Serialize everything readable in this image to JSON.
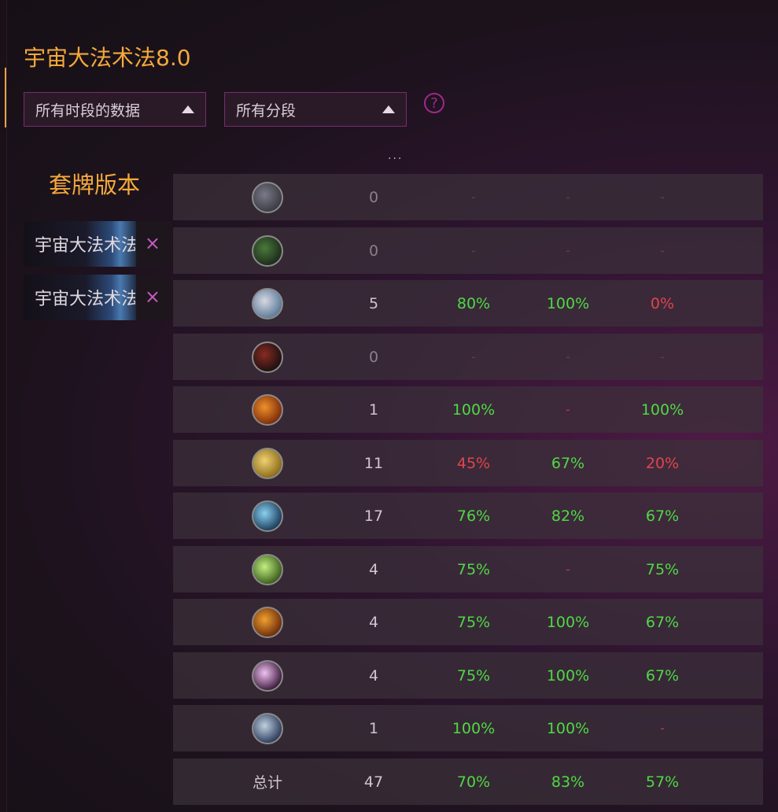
{
  "page": {
    "title": "宇宙大法术法8.0"
  },
  "filters": {
    "period_label": "所有时段的数据",
    "segment_label": "所有分段",
    "help_label": "?"
  },
  "misc": {
    "dots": "..."
  },
  "decks": {
    "header": "套牌版本",
    "items": [
      {
        "name": "宇宙大法术法",
        "close": "×"
      },
      {
        "name": "宇宙大法术法",
        "close": "×"
      }
    ]
  },
  "table": {
    "rows": [
      {
        "icon": "gray-dragon-icon",
        "count": "0",
        "a": "-",
        "b": "-",
        "c": "-",
        "a_cls": "dash",
        "b_cls": "dash",
        "c_cls": "dash",
        "dim": true
      },
      {
        "icon": "green-orc-icon",
        "count": "0",
        "a": "-",
        "b": "-",
        "c": "-",
        "a_cls": "dash",
        "b_cls": "dash",
        "c_cls": "dash",
        "dim": true
      },
      {
        "icon": "white-claw-icon",
        "count": "5",
        "a": "80%",
        "b": "100%",
        "c": "0%",
        "a_cls": "green",
        "b_cls": "green",
        "c_cls": "red",
        "dim": false
      },
      {
        "icon": "red-bow-icon",
        "count": "0",
        "a": "-",
        "b": "-",
        "c": "-",
        "a_cls": "dash",
        "b_cls": "dash",
        "c_cls": "dash",
        "dim": true
      },
      {
        "icon": "fire-icon",
        "count": "1",
        "a": "100%",
        "b": "-",
        "c": "100%",
        "a_cls": "green",
        "b_cls": "dash",
        "c_cls": "green",
        "dim": false
      },
      {
        "icon": "gold-scroll-icon",
        "count": "11",
        "a": "45%",
        "b": "67%",
        "c": "20%",
        "a_cls": "red",
        "b_cls": "green",
        "c_cls": "red",
        "dim": false
      },
      {
        "icon": "blue-hammer-icon",
        "count": "17",
        "a": "76%",
        "b": "82%",
        "c": "67%",
        "a_cls": "green",
        "b_cls": "green",
        "c_cls": "green",
        "dim": false
      },
      {
        "icon": "green-bolt-icon",
        "count": "4",
        "a": "75%",
        "b": "-",
        "c": "75%",
        "a_cls": "green",
        "b_cls": "dash",
        "c_cls": "green",
        "dim": false
      },
      {
        "icon": "orange-banner-icon",
        "count": "4",
        "a": "75%",
        "b": "100%",
        "c": "67%",
        "a_cls": "green",
        "b_cls": "green",
        "c_cls": "green",
        "dim": false
      },
      {
        "icon": "purple-hand-icon",
        "count": "4",
        "a": "75%",
        "b": "100%",
        "c": "67%",
        "a_cls": "green",
        "b_cls": "green",
        "c_cls": "green",
        "dim": false
      },
      {
        "icon": "steel-sword-icon",
        "count": "1",
        "a": "100%",
        "b": "100%",
        "c": "-",
        "a_cls": "green",
        "b_cls": "green",
        "c_cls": "dash",
        "dim": false
      }
    ],
    "total": {
      "label": "总计",
      "count": "47",
      "a": "70%",
      "b": "83%",
      "c": "57%"
    }
  },
  "icon_colors": {
    "gray-dragon-icon": [
      "#3a3a44",
      "#7a7a88"
    ],
    "green-orc-icon": [
      "#1c2a1a",
      "#4a7a3a"
    ],
    "white-claw-icon": [
      "#5a7a9a",
      "#d8d8e0"
    ],
    "red-bow-icon": [
      "#1a1012",
      "#8a2a22"
    ],
    "fire-icon": [
      "#7a2a0a",
      "#f0902a"
    ],
    "gold-scroll-icon": [
      "#8a6a1a",
      "#f0d070"
    ],
    "blue-hammer-icon": [
      "#1a3a5a",
      "#8ad0f0"
    ],
    "green-bolt-icon": [
      "#3a5a1a",
      "#c0f080"
    ],
    "orange-banner-icon": [
      "#6a2a0a",
      "#f0a030"
    ],
    "purple-hand-icon": [
      "#3a1a3a",
      "#f0c0f0"
    ],
    "steel-sword-icon": [
      "#2a3a5a",
      "#c0d0e0"
    ]
  }
}
